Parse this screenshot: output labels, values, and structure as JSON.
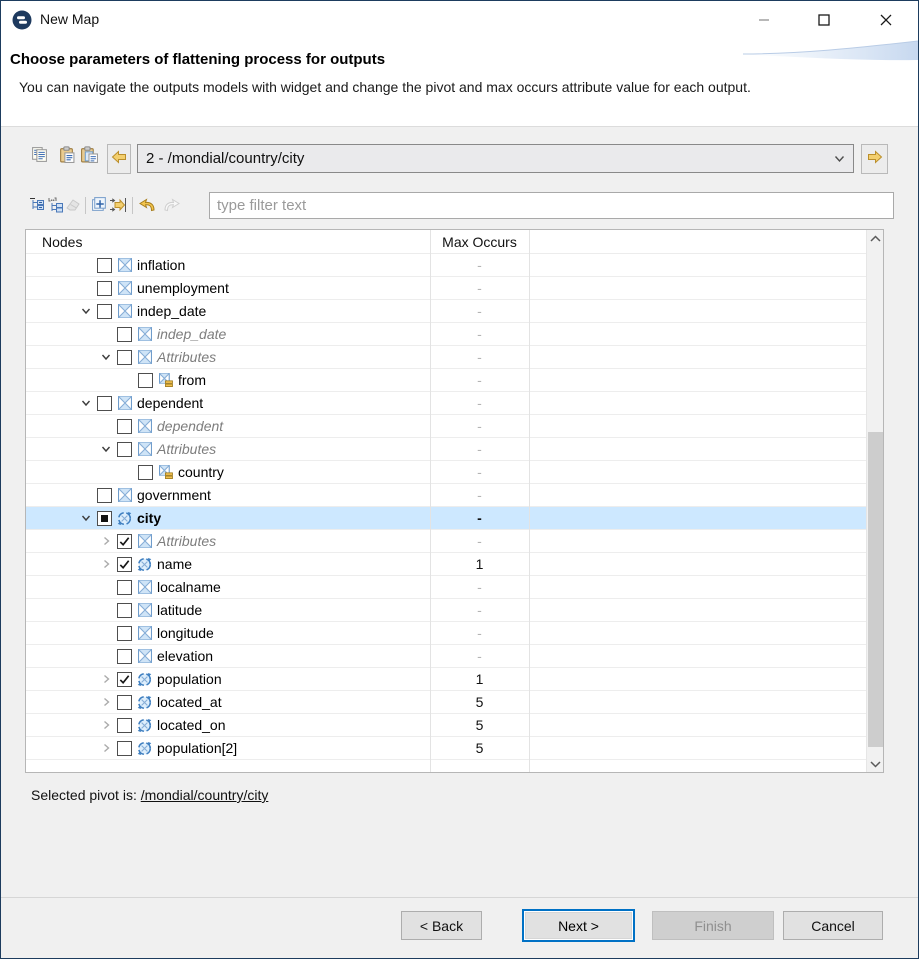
{
  "window": {
    "title": "New Map"
  },
  "banner": {
    "title": "Choose parameters of flattening process for outputs",
    "description": "You can navigate the outputs models with widget and change the pivot and max occurs attribute value for each output."
  },
  "toolbar": {
    "clipboard_icons": [
      "copy-icon",
      "paste-icon",
      "paste-structure-icon"
    ],
    "nav_prev_icon": "arrow-left-icon",
    "nav_next_icon": "arrow-right-icon",
    "combo_value": "2 - /mondial/country/city",
    "tree_tool_icons": [
      "collapse-all-icon",
      "expand-levels-icon",
      "clear-filter-icon",
      "expand-node-icon",
      "set-pivot-icon",
      "undo-icon",
      "redo-icon"
    ],
    "filter_placeholder": "type filter text"
  },
  "tree": {
    "columns": {
      "nodes": "Nodes",
      "max_occurs": "Max Occurs"
    },
    "rows": [
      {
        "label": "inflation",
        "level": 1,
        "chevron": "none",
        "checkbox": "unchecked",
        "icon": "element",
        "style": "normal",
        "max": "-",
        "selected": false
      },
      {
        "label": "unemployment",
        "level": 1,
        "chevron": "none",
        "checkbox": "unchecked",
        "icon": "element",
        "style": "normal",
        "max": "-",
        "selected": false
      },
      {
        "label": "indep_date",
        "level": 1,
        "chevron": "down",
        "checkbox": "unchecked",
        "icon": "element",
        "style": "normal",
        "max": "-",
        "selected": false
      },
      {
        "label": "indep_date",
        "level": 2,
        "chevron": "none",
        "checkbox": "unchecked",
        "icon": "element",
        "style": "italic",
        "max": "-",
        "selected": false
      },
      {
        "label": "Attributes",
        "level": 2,
        "chevron": "down",
        "checkbox": "unchecked",
        "icon": "element",
        "style": "italic",
        "max": "-",
        "selected": false
      },
      {
        "label": "from",
        "level": 3,
        "chevron": "none",
        "checkbox": "unchecked",
        "icon": "attribute",
        "style": "normal",
        "max": "-",
        "selected": false
      },
      {
        "label": "dependent",
        "level": 1,
        "chevron": "down",
        "checkbox": "unchecked",
        "icon": "element",
        "style": "normal",
        "max": "-",
        "selected": false
      },
      {
        "label": "dependent",
        "level": 2,
        "chevron": "none",
        "checkbox": "unchecked",
        "icon": "element",
        "style": "italic",
        "max": "-",
        "selected": false
      },
      {
        "label": "Attributes",
        "level": 2,
        "chevron": "down",
        "checkbox": "unchecked",
        "icon": "element",
        "style": "italic",
        "max": "-",
        "selected": false
      },
      {
        "label": "country",
        "level": 3,
        "chevron": "none",
        "checkbox": "unchecked",
        "icon": "attribute",
        "style": "normal",
        "max": "-",
        "selected": false
      },
      {
        "label": "government",
        "level": 1,
        "chevron": "none",
        "checkbox": "unchecked",
        "icon": "element",
        "style": "normal",
        "max": "-",
        "selected": false
      },
      {
        "label": "city",
        "level": 1,
        "chevron": "down",
        "checkbox": "mixed",
        "icon": "recursive",
        "style": "bold",
        "max": "-",
        "selected": true
      },
      {
        "label": "Attributes",
        "level": 2,
        "chevron": "right",
        "checkbox": "checked",
        "icon": "element",
        "style": "italic",
        "max": "-",
        "selected": false
      },
      {
        "label": "name",
        "level": 2,
        "chevron": "right",
        "checkbox": "checked",
        "icon": "recursive",
        "style": "normal",
        "max": "1",
        "selected": false
      },
      {
        "label": "localname",
        "level": 2,
        "chevron": "none",
        "checkbox": "unchecked",
        "icon": "element",
        "style": "normal",
        "max": "-",
        "selected": false
      },
      {
        "label": "latitude",
        "level": 2,
        "chevron": "none",
        "checkbox": "unchecked",
        "icon": "element",
        "style": "normal",
        "max": "-",
        "selected": false
      },
      {
        "label": "longitude",
        "level": 2,
        "chevron": "none",
        "checkbox": "unchecked",
        "icon": "element",
        "style": "normal",
        "max": "-",
        "selected": false
      },
      {
        "label": "elevation",
        "level": 2,
        "chevron": "none",
        "checkbox": "unchecked",
        "icon": "element",
        "style": "normal",
        "max": "-",
        "selected": false
      },
      {
        "label": "population",
        "level": 2,
        "chevron": "right",
        "checkbox": "checked",
        "icon": "recursive",
        "style": "normal",
        "max": "1",
        "selected": false
      },
      {
        "label": "located_at",
        "level": 2,
        "chevron": "right",
        "checkbox": "unchecked",
        "icon": "recursive",
        "style": "normal",
        "max": "5",
        "selected": false
      },
      {
        "label": "located_on",
        "level": 2,
        "chevron": "right",
        "checkbox": "unchecked",
        "icon": "recursive",
        "style": "normal",
        "max": "5",
        "selected": false
      },
      {
        "label": "population[2]",
        "level": 2,
        "chevron": "right",
        "checkbox": "unchecked",
        "icon": "recursive",
        "style": "normal",
        "max": "5",
        "selected": false
      }
    ]
  },
  "pivot": {
    "label": "Selected pivot is:",
    "value": "/mondial/country/city"
  },
  "buttons": {
    "back": "< Back",
    "next": "Next >",
    "finish": "Finish",
    "cancel": "Cancel"
  },
  "colors": {
    "selection": "#cde8ff",
    "focus_accent": "#0071c5",
    "gold": "#f0c24b"
  }
}
